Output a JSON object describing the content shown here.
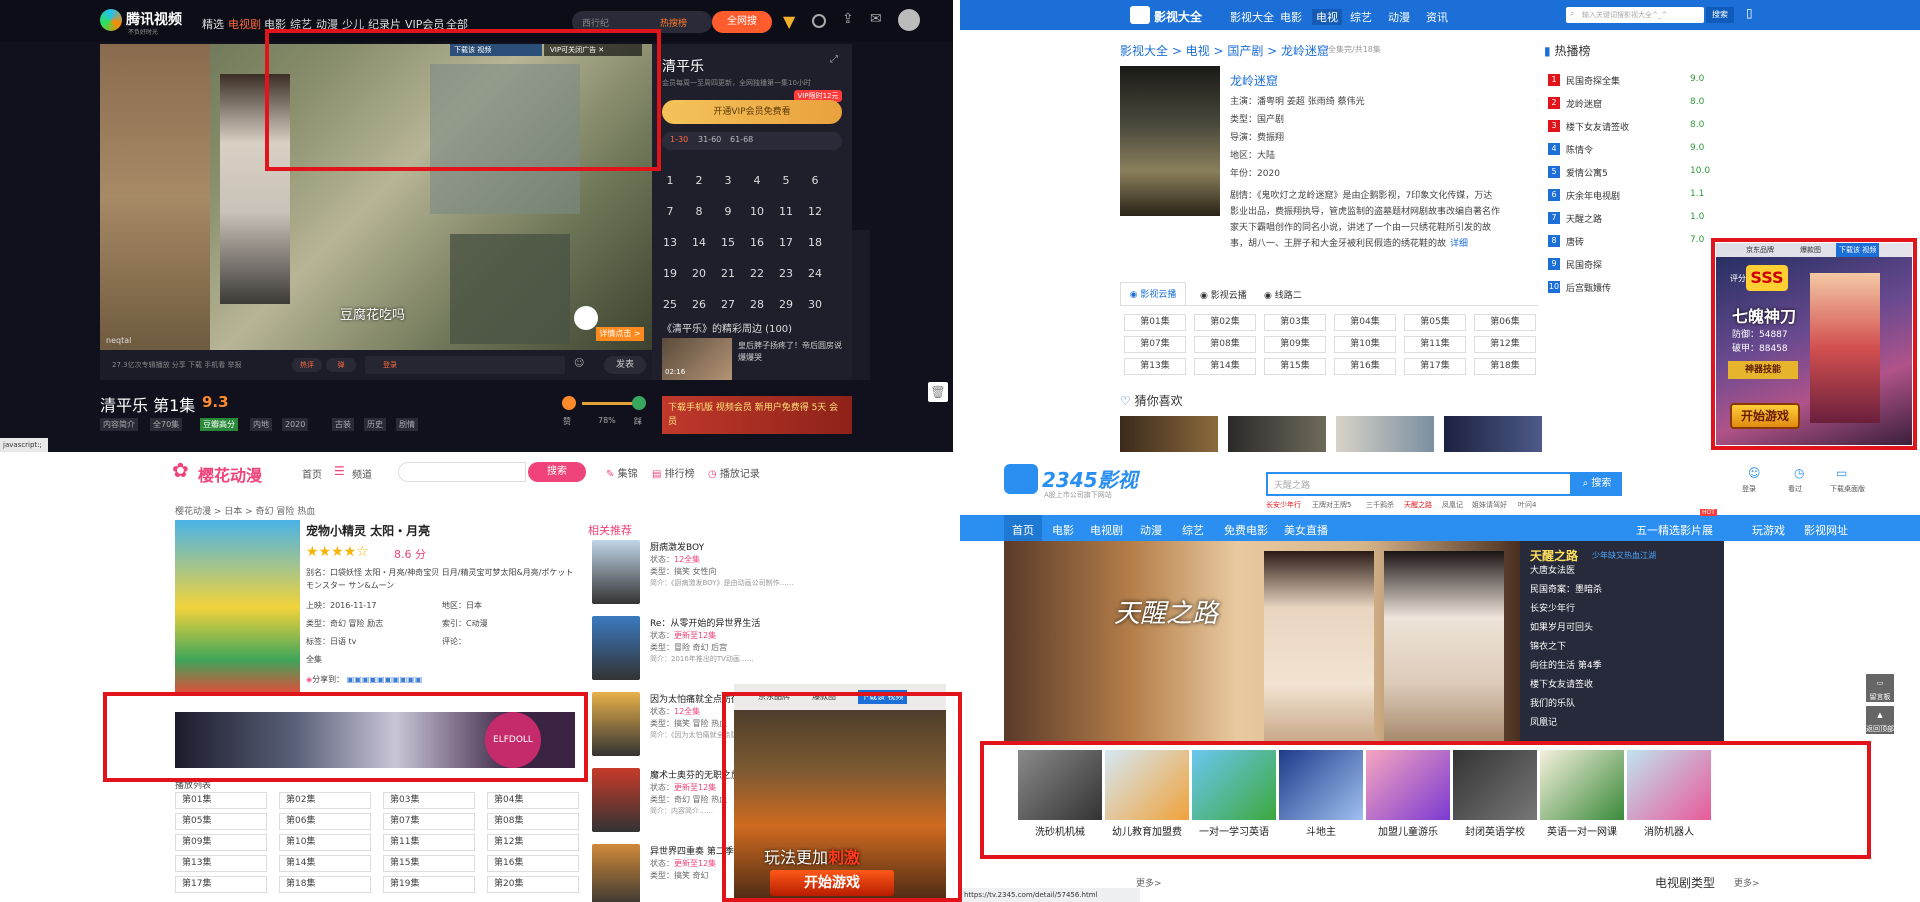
{
  "q1": {
    "logo": "腾讯视频",
    "logo_sub": "不负好时光",
    "nav": [
      "精选",
      "电视剧",
      "电影",
      "综艺",
      "动漫",
      "少儿",
      "纪录片",
      "VIP会员",
      "全部"
    ],
    "search_placeholder": "西行纪",
    "hot_label": "热搜榜",
    "search_btn": "全网搜",
    "ad_tip": "VIP可关闭广告",
    "ad_dl": "下载该 视频",
    "subtitle": "豆腐花吃吗",
    "brand_wm": "neqtal",
    "detail_btn": "详情点击 >",
    "ctrl_text": "27.3亿次专辑播放  分享  下载  手机看  举报",
    "ctrl_hot": "热评",
    "ctrl_bullet": "弹",
    "ctrl_login": "登录",
    "send": "发表",
    "title": "清平乐 第1集",
    "score": "9.3",
    "tags": [
      "内容简介",
      "全70集",
      "豆瓣高分",
      "内地",
      "2020",
      "古装",
      "历史",
      "剧情"
    ],
    "rate_pct": "78%",
    "rate_good": "赞",
    "rate_bad": "踩",
    "side_title": "清平乐",
    "side_desc": "会员每周一至周四更新，全网独播第一集10小时",
    "vip_tag": "VIP限时12元",
    "vip_btn": "开通VIP会员免费看",
    "ranges": [
      "1-30",
      "31-60",
      "61-68"
    ],
    "episodes": [
      "1",
      "2",
      "3",
      "4",
      "5",
      "6",
      "7",
      "8",
      "9",
      "10",
      "11",
      "12",
      "13",
      "14",
      "15",
      "16",
      "17",
      "18",
      "19",
      "20",
      "21",
      "22",
      "23",
      "24",
      "25",
      "26",
      "27",
      "28",
      "29",
      "30"
    ],
    "clips_title": "《清平乐》的精彩周边 (100)",
    "clip_text": "皇后脾子扬疼了！帝后圆房说爆爆哭",
    "clip_time": "02:16",
    "bottom_ad": "下载手机版 视频会员 新用户免费得 5天 会员",
    "statusbar": "javascript:;"
  },
  "q2": {
    "logo": "影视大全",
    "nav": [
      "影视大全",
      "电影",
      "电视",
      "综艺",
      "动漫",
      "资讯"
    ],
    "search_placeholder": "输入关键词搜影视大全^_^",
    "search_btn": "搜索",
    "breadcrumb": "影视大全 > 电视 > 国产剧 > 龙岭迷窟",
    "breadcrumb_suffix": "全集完/共18集",
    "title": "龙岭迷窟",
    "info": [
      {
        "k": "主演：",
        "v": "潘粤明  姜超  张雨绮  蔡伟光"
      },
      {
        "k": "类型：",
        "v": "国产剧"
      },
      {
        "k": "导演：",
        "v": "费振翔"
      },
      {
        "k": "地区：",
        "v": "大陆"
      },
      {
        "k": "年份：",
        "v": "2020"
      }
    ],
    "plot_label": "剧情：",
    "plot": "《鬼吹灯之龙岭迷窟》是由企鹅影视，7印象文化传媒，万达影业出品，费振翔执导，管虎监制的盗墓题材网剧故事改编自著名作家天下霸唱创作的同名小说，讲述了一个由一只绣花鞋所引发的故事，胡八一、王胖子和大金牙被利民假造的绣花鞋的故",
    "plot_more": "详细",
    "sources": [
      "影视云播",
      "影视云播",
      "线路二"
    ],
    "episodes": [
      "第01集",
      "第02集",
      "第03集",
      "第04集",
      "第05集",
      "第06集",
      "第07集",
      "第08集",
      "第09集",
      "第10集",
      "第11集",
      "第12集",
      "第13集",
      "第14集",
      "第15集",
      "第16集",
      "第17集",
      "第18集"
    ],
    "guess": "猜你喜欢",
    "hot_title": "热播榜",
    "hot": [
      {
        "name": "民国奇探全集",
        "score": "9.0"
      },
      {
        "name": "龙岭迷窟",
        "score": "8.0"
      },
      {
        "name": "楼下女友请签收",
        "score": "8.0"
      },
      {
        "name": "陈情令",
        "score": "9.0"
      },
      {
        "name": "爱情公寓5",
        "score": "10.0"
      },
      {
        "name": "庆余年电视剧",
        "score": "1.1"
      },
      {
        "name": "天醒之路",
        "score": "1.0"
      },
      {
        "name": "唐砖",
        "score": "7.0"
      },
      {
        "name": "民国奇探",
        "score": ""
      },
      {
        "name": "后宫甄嬛传",
        "score": ""
      }
    ],
    "game_ad": {
      "top_a": "京东品牌",
      "top_b": "爆款图",
      "dl": "下载该 视频",
      "score_label": "评分",
      "title": "七魄神刀",
      "line1": "防御：54887",
      "line2": "破甲：88458",
      "skill": "神器技能",
      "start": "开始游戏"
    }
  },
  "q3": {
    "logo": "樱花动漫",
    "nav": [
      "首页",
      "频道"
    ],
    "search_btn": "搜索",
    "links": [
      "集锦",
      "排行榜",
      "播放记录"
    ],
    "breadcrumb": "樱花动漫 > 日本 > 奇幻 冒险 热血",
    "title": "宠物小精灵 太阳・月亮",
    "score": "8.6",
    "score_unit": "分",
    "alias": "别名：口袋妖怪 太阳・月亮/神奇宝贝 日月/精灵宝可梦太阳&月亮/ポケットモンスター サン&ムーン",
    "details": [
      {
        "k": "上映：",
        "v": "2016-11-17"
      },
      {
        "k": "地区：",
        "v": "日本"
      },
      {
        "k": "类型：",
        "v": "奇幻 冒险 励志"
      },
      {
        "k": "索引：",
        "v": "C动漫"
      },
      {
        "k": "标签：",
        "v": "日语 tv"
      },
      {
        "k": "评论：",
        "v": ""
      }
    ],
    "full": "全集",
    "share": "分享到：",
    "banner_ad": "ELFDOLL",
    "list_label": "播放列表",
    "episodes": [
      "第01集",
      "第02集",
      "第03集",
      "第04集",
      "第05集",
      "第06集",
      "第07集",
      "第08集",
      "第09集",
      "第10集",
      "第11集",
      "第12集",
      "第13集",
      "第14集",
      "第15集",
      "第16集",
      "第17集",
      "第18集",
      "第19集",
      "第20集"
    ],
    "rec_title": "相关推荐",
    "recs": [
      {
        "title": "厨病激发BOY",
        "status": "12全集",
        "type": "搞笑 女性向",
        "desc": "简介：《厨病激发BOY》是由动画公司制作……"
      },
      {
        "title": "Re：从零开始的异世界生活",
        "status": "更新至12集",
        "type": "冒险 奇幻 后宫",
        "desc": "简介：2016年推出的TV动画……"
      },
      {
        "title": "因为太怕痛就全点防御力了",
        "status": "12全集",
        "type": "搞笑 冒险 热血",
        "desc": "简介：《因为太怕痛就全点防御力了》……"
      },
      {
        "title": "魔术士奥芬的无职之旅",
        "status": "更新至12集",
        "type": "奇幻 冒险 热血",
        "desc": "简介：内容简介……"
      },
      {
        "title": "异世界四重奏 第二季",
        "status": "更新至12集",
        "type": "搞笑 奇幻",
        "desc": ""
      }
    ],
    "game_ad": {
      "top_a": "京东品牌",
      "top_b": "爆款图",
      "dl": "下载该 视频",
      "tagline": "玩法更加",
      "hot": "刺激",
      "start": "开始游戏"
    }
  },
  "q4": {
    "logo": "2345影视",
    "logo_sub": "A股上市公司旗下网站",
    "search_placeholder": "天醒之路",
    "search_btn": "搜索",
    "hot_searches": [
      "长安少年行",
      "王牌对王牌5",
      "三千鸦杀",
      "天醒之路",
      "凤凰记",
      "姐妹请驾好",
      "叶问4"
    ],
    "top_icons": [
      "登录",
      "看过",
      "下载桌面版"
    ],
    "nav": [
      "首页",
      "电影",
      "电视剧",
      "动漫",
      "综艺",
      "免费电影",
      "美女直播"
    ],
    "nav_right": [
      "五一精选影片展",
      "玩游戏",
      "影视网址"
    ],
    "nav_badge": "HOT",
    "banner_title": "天醒之路",
    "banner_title_sub": "少年缺又热血江湖",
    "banner_list": [
      "大唐女法医",
      "民国奇案：墨暗杀",
      "长安少年行",
      "如果岁月可回头",
      "锦衣之下",
      "向往的生活 第4季",
      "楼下女友请签收",
      "我们的乐队",
      "凤凰记"
    ],
    "banner_calligraphy": "天醒之路",
    "side_btns": [
      "留言板",
      "返回顶部"
    ],
    "thumbs": [
      "洗砂机机械",
      "幼儿教育加盟费",
      "一对一学习英语",
      "斗地主",
      "加盟儿童游乐",
      "封闭英语学校",
      "英语一对一网课",
      "消防机器人"
    ],
    "section_more": "更多>",
    "section_right": "电视剧类型",
    "url": "https://tv.2345.com/detail/57456.html"
  }
}
